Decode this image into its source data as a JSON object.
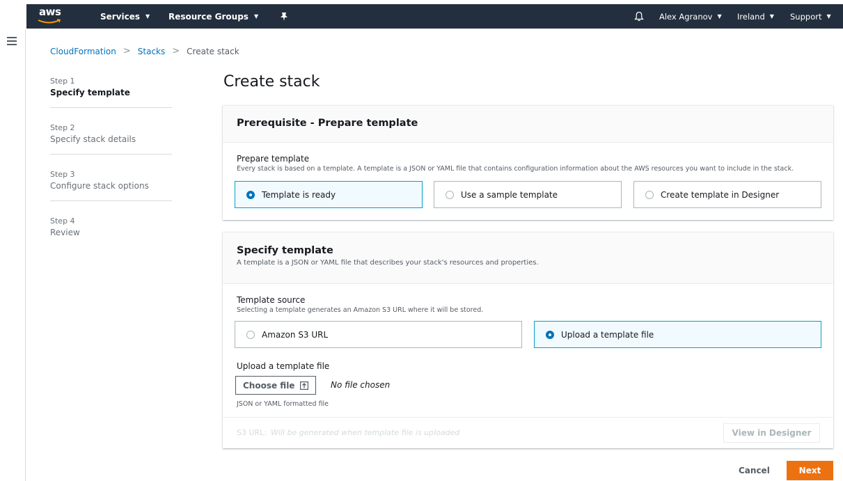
{
  "topnav": {
    "logo_text": "aws",
    "services_label": "Services",
    "resource_groups_label": "Resource Groups",
    "user_label": "Alex Agranov",
    "region_label": "Ireland",
    "support_label": "Support"
  },
  "breadcrumb": {
    "items": [
      "CloudFormation",
      "Stacks",
      "Create stack"
    ]
  },
  "steps": [
    {
      "num": "Step 1",
      "label": "Specify template",
      "active": true
    },
    {
      "num": "Step 2",
      "label": "Specify stack details",
      "active": false
    },
    {
      "num": "Step 3",
      "label": "Configure stack options",
      "active": false
    },
    {
      "num": "Step 4",
      "label": "Review",
      "active": false
    }
  ],
  "page_title": "Create stack",
  "prereq_panel": {
    "title": "Prerequisite - Prepare template",
    "field_label": "Prepare template",
    "field_desc": "Every stack is based on a template. A template is a JSON or YAML file that contains configuration information about the AWS resources you want to include in the stack.",
    "options": [
      {
        "label": "Template is ready",
        "selected": true
      },
      {
        "label": "Use a sample template",
        "selected": false
      },
      {
        "label": "Create template in Designer",
        "selected": false
      }
    ]
  },
  "specify_panel": {
    "title": "Specify template",
    "desc": "A template is a JSON or YAML file that describes your stack's resources and properties.",
    "source_label": "Template source",
    "source_desc": "Selecting a template generates an Amazon S3 URL where it will be stored.",
    "options": [
      {
        "label": "Amazon S3 URL",
        "selected": false
      },
      {
        "label": "Upload a template file",
        "selected": true
      }
    ],
    "upload_label": "Upload a template file",
    "choose_file_label": "Choose file",
    "no_file_text": "No file chosen",
    "upload_hint": "JSON or YAML formatted file",
    "s3url_label": "S3 URL:",
    "s3url_placeholder": "Will be generated when template file is uploaded",
    "view_designer_label": "View in Designer"
  },
  "footer": {
    "cancel_label": "Cancel",
    "next_label": "Next"
  },
  "colors": {
    "nav_bg": "#232f3e",
    "link": "#0073bb",
    "accent_orange": "#ec7211",
    "selected_border": "#00a1c9"
  }
}
